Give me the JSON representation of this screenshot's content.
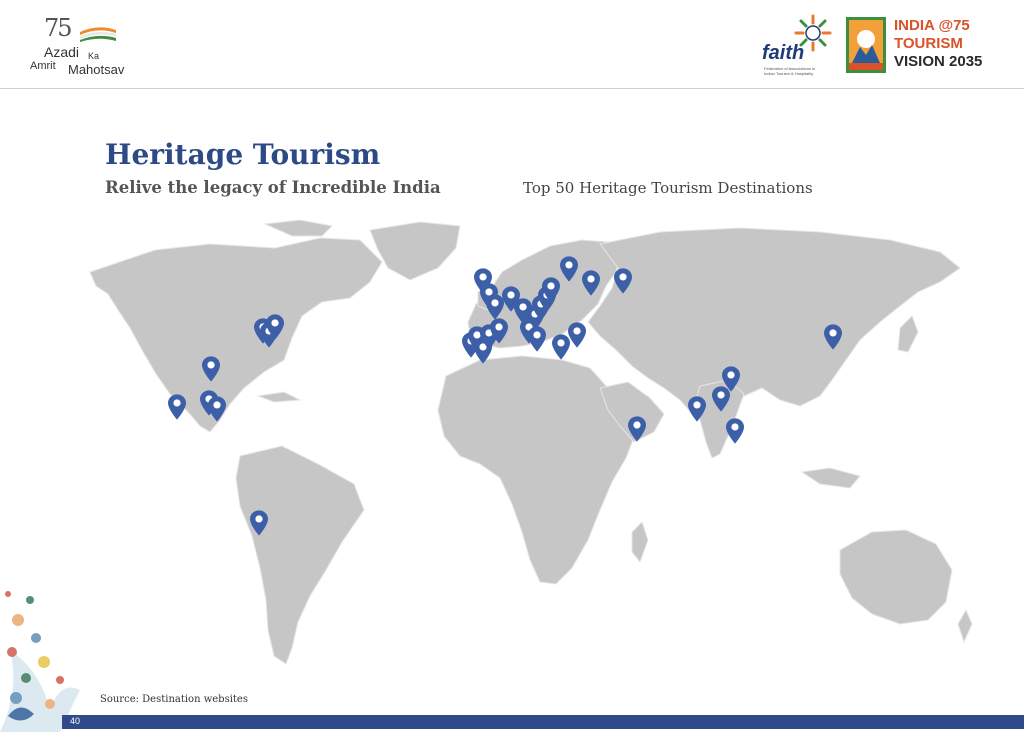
{
  "header": {
    "azadi_logo": {
      "number": "75",
      "line1": "Azadi",
      "line2": "Ka",
      "line3": "Amrit",
      "line4": "Mahotsav"
    },
    "faith_logo": {
      "word": "faith",
      "subtitle": "Federation of Associations in Indian Tourism & Hospitality"
    },
    "india75_logo": {
      "line1": "INDIA @75",
      "line2": "TOURISM",
      "line3": "VISION 2035"
    }
  },
  "slide": {
    "title": "Heritage Tourism",
    "subtitle": "Relive the legacy of Incredible India",
    "map_caption": "Top 50 Heritage Tourism Destinations",
    "source": "Source: Destination websites",
    "page_number": "40"
  },
  "colors": {
    "title": "#2c4a86",
    "pin": "#3c5fa8",
    "land": "#c6c6c6",
    "footer_bar": "#2f4a8a"
  },
  "icons": {
    "pin": "map-pin-icon"
  }
}
